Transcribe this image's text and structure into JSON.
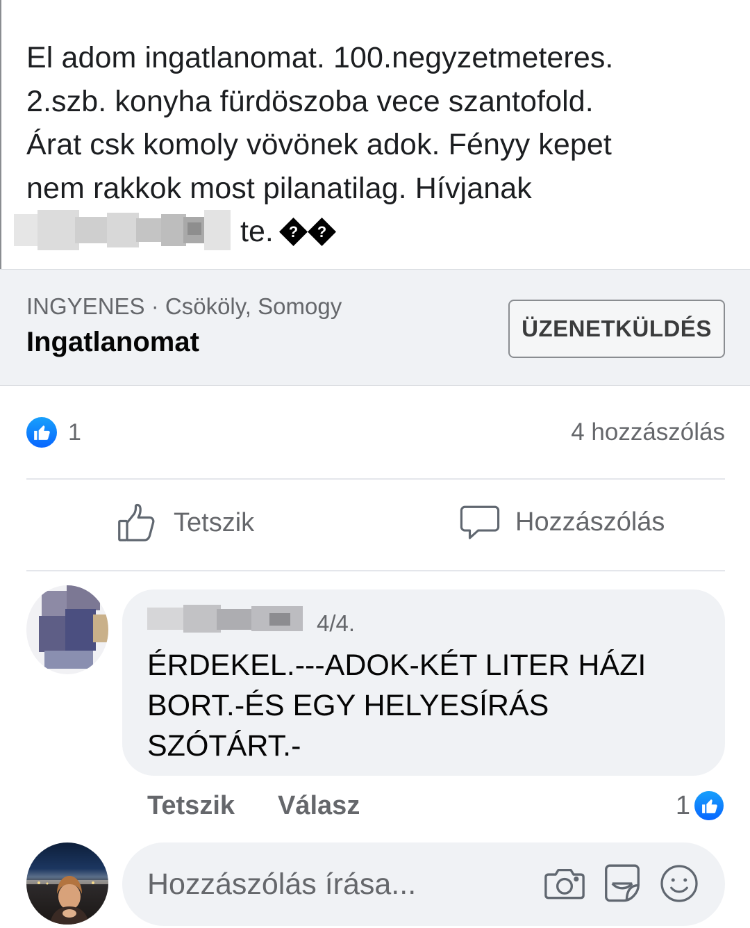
{
  "post": {
    "text_lines": [
      "El adom ingatlanomat. 100.negyzetmeteres.",
      "2.szb. konyha fürdöszoba vece szantofold.",
      "Árat csk komoly vövönek adok. Fényy kepet",
      "nem rakkok most pilanatilag. Hívjanak"
    ],
    "last_line_visible": "te.",
    "replacement_glyph": "?"
  },
  "marketplace": {
    "price": "INGYENES",
    "separator": "·",
    "location": "Csököly, Somogy",
    "title": "Ingatlanomat",
    "message_button": "ÜZENETKÜLDÉS"
  },
  "stats": {
    "likes": "1",
    "comments": "4 hozzászólás"
  },
  "actions": {
    "like": "Tetszik",
    "comment": "Hozzászólás"
  },
  "comment": {
    "date": "4/4.",
    "lines": [
      "ÉRDEKEL.---ADOK-KÉT LITER HÁZI",
      "BORT.-ÉS EGY HELYESÍRÁS",
      "SZÓTÁRT.-"
    ],
    "like_action": "Tetszik",
    "reply_action": "Válasz",
    "like_count": "1"
  },
  "composer": {
    "placeholder": "Hozzászólás írása..."
  },
  "icons": [
    "like-icon",
    "thumbs-up-outline-icon",
    "speech-bubble-icon",
    "camera-icon",
    "sticker-icon",
    "emoji-icon"
  ],
  "colors": {
    "brand_blue": "#0866ff",
    "text_primary": "#1c1e21",
    "text_secondary": "#65676b",
    "surface_gray": "#f0f2f5"
  }
}
